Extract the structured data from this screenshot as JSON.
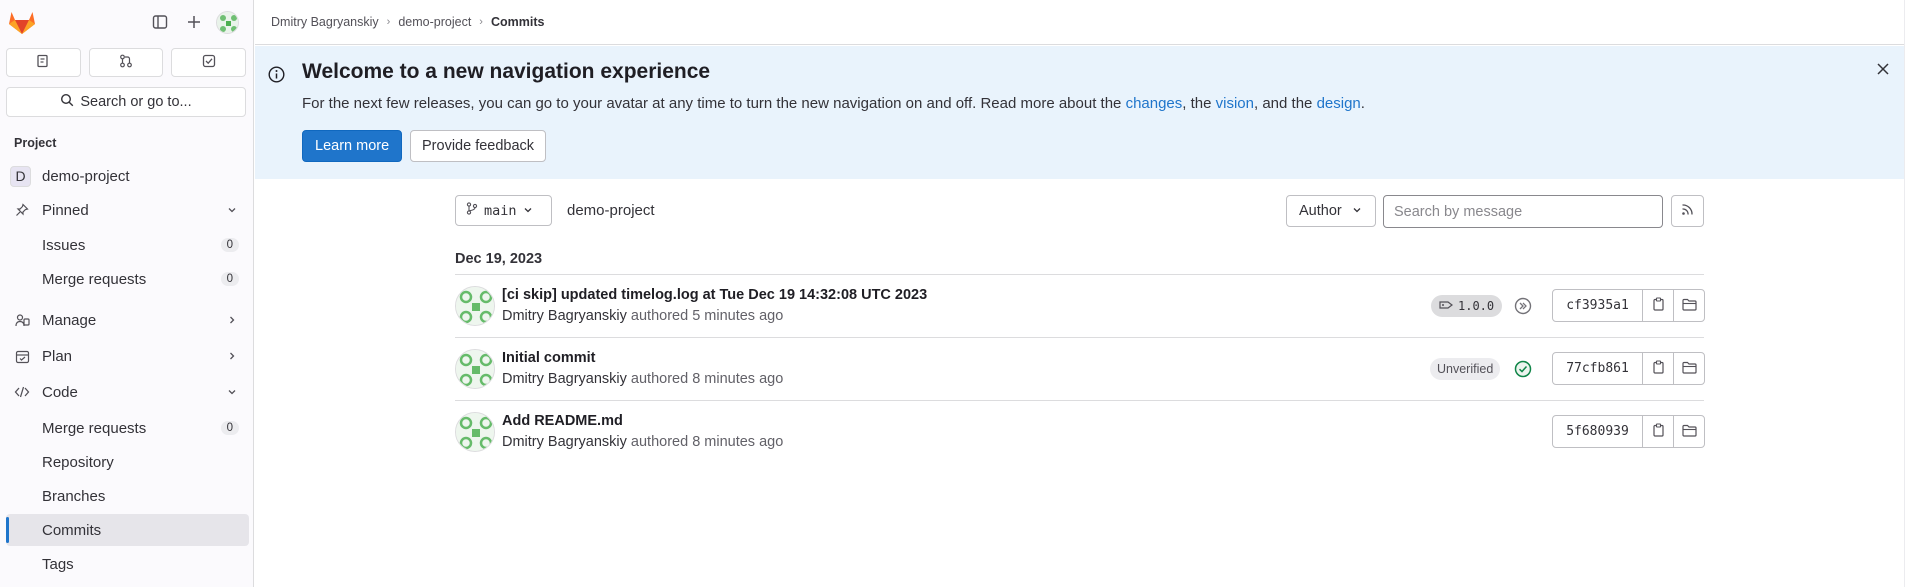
{
  "sidebar": {
    "tabs": [
      {
        "icon": "issues-icon"
      },
      {
        "icon": "merge-request-icon"
      },
      {
        "icon": "todo-icon"
      }
    ],
    "search_label": "Search or go to...",
    "section_title": "Project",
    "project_badge": "D",
    "project_name": "demo-project",
    "pinned_label": "Pinned",
    "pinned_items": [
      {
        "label": "Issues",
        "count": "0"
      },
      {
        "label": "Merge requests",
        "count": "0"
      }
    ],
    "manage_label": "Manage",
    "plan_label": "Plan",
    "code_label": "Code",
    "code_items": [
      {
        "label": "Merge requests",
        "count": "0"
      },
      {
        "label": "Repository"
      },
      {
        "label": "Branches"
      },
      {
        "label": "Commits"
      },
      {
        "label": "Tags"
      }
    ]
  },
  "breadcrumb": {
    "items": [
      "Dmitry Bagryanskiy",
      "demo-project",
      "Commits"
    ]
  },
  "banner": {
    "title": "Welcome to a new navigation experience",
    "text_before": "For the next few releases, you can go to your avatar at any time to turn the new navigation on and off. Read more about the ",
    "link_changes": "changes",
    "text_mid1": ", the ",
    "link_vision": "vision",
    "text_mid2": ", and the ",
    "link_design": "design",
    "text_end": ".",
    "learn_more": "Learn more",
    "feedback": "Provide feedback"
  },
  "filters": {
    "branch": "main",
    "path": "demo-project",
    "author_label": "Author",
    "search_placeholder": "Search by message"
  },
  "date_header": "Dec 19, 2023",
  "commits": [
    {
      "title": "[ci skip] updated timelog.log at Tue Dec 19 14:32:08 UTC 2023",
      "author": "Dmitry Bagryanskiy",
      "authored": "authored 5 minutes ago",
      "tag": "1.0.0",
      "status": "skipped",
      "sha": "cf3935a1"
    },
    {
      "title": "Initial commit",
      "author": "Dmitry Bagryanskiy",
      "authored": "authored 8 minutes ago",
      "verification": "Unverified",
      "status": "passed",
      "sha": "77cfb861"
    },
    {
      "title": "Add README.md",
      "author": "Dmitry Bagryanskiy",
      "authored": "authored 8 minutes ago",
      "sha": "5f680939"
    }
  ],
  "colors": {
    "accent": "#1f75cb",
    "banner_bg": "#e9f3fc",
    "success": "#108548"
  }
}
